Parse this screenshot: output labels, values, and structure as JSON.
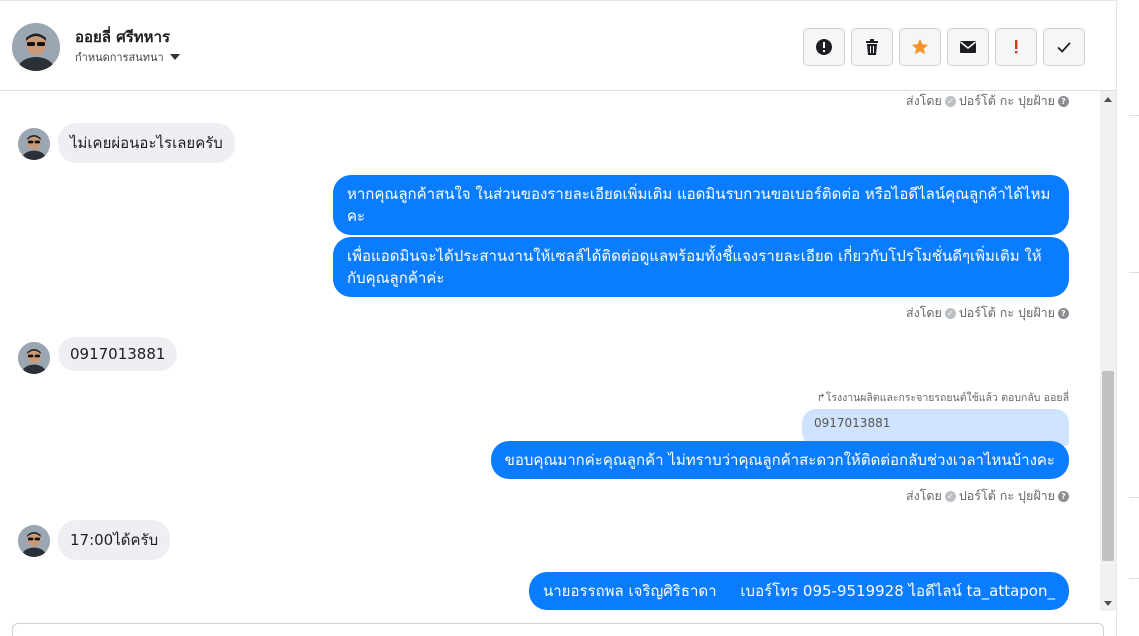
{
  "header": {
    "contact_name": "ออยลี่ ศรีทหาร",
    "assign_label": "กำหนดการสนทนา",
    "actions": [
      {
        "name": "report-icon",
        "color": "#1c1e21"
      },
      {
        "name": "trash-icon",
        "color": "#1c1e21"
      },
      {
        "name": "star-icon",
        "color": "#f5902a"
      },
      {
        "name": "envelope-icon",
        "color": "#1c1e21"
      },
      {
        "name": "exclamation-icon",
        "color": "#e0301e"
      },
      {
        "name": "check-icon",
        "color": "#1c1e21"
      }
    ]
  },
  "messages": {
    "meta_prefix": "ส่งโดย",
    "meta_author": "ปอร์โต้ กะ ปุยฝ้าย",
    "meta_top": {
      "prefix": "ส่งโดย",
      "author": "ปอร์โต้ กะ ปุยฝ้าย"
    },
    "in_1": "ไม่เคยผ่อนอะไรเลยครับ",
    "out_1": "หากคุณลูกค้าสนใจ ในส่วนของรายละเอียดเพิ่มเติม แอดมินรบกวนขอเบอร์ติดต่อ หรือไอดีไลน์คุณลูกค้าได้ไหมคะ",
    "out_2": "เพื่อแอดมินจะได้ประสานงานให้เซลล์ได้ติดต่อดูแลพร้อมทั้งชี้แจงรายละเอียด เกี่ยวกับโปรโมชั่นดีๆเพิ่มเติม ให้กับคุณลูกค้าค่ะ",
    "meta_2": {
      "prefix": "ส่งโดย",
      "author": "ปอร์โต้ กะ ปุยฝ้าย"
    },
    "in_2": "0917013881",
    "reply_note": "โรงงานผลิตและกระจายรถยนต์ใช้แล้ว ตอบกลับ ออยลี่",
    "quote": "0917013881",
    "out_3": "ขอบคุณมากค่ะคุณลูกค้า ไม่ทราบว่าคุณลูกค้าสะดวกให้ติดต่อกลับช่วงเวลาไหนบ้างคะ",
    "meta_3": {
      "prefix": "ส่งโดย",
      "author": "ปอร์โต้ กะ ปุยฝ้าย"
    },
    "in_3": "17:00ได้ครับ",
    "out_4": "นายอรรถพล เจริญศิริธาดา     เบอร์โทร 095-9519928 ไอดีไลน์ ta_attapon_"
  },
  "colors": {
    "outgoing": "#0a7cff",
    "incoming": "#eeeff2",
    "accent_star": "#f5902a",
    "alert": "#e0301e"
  }
}
